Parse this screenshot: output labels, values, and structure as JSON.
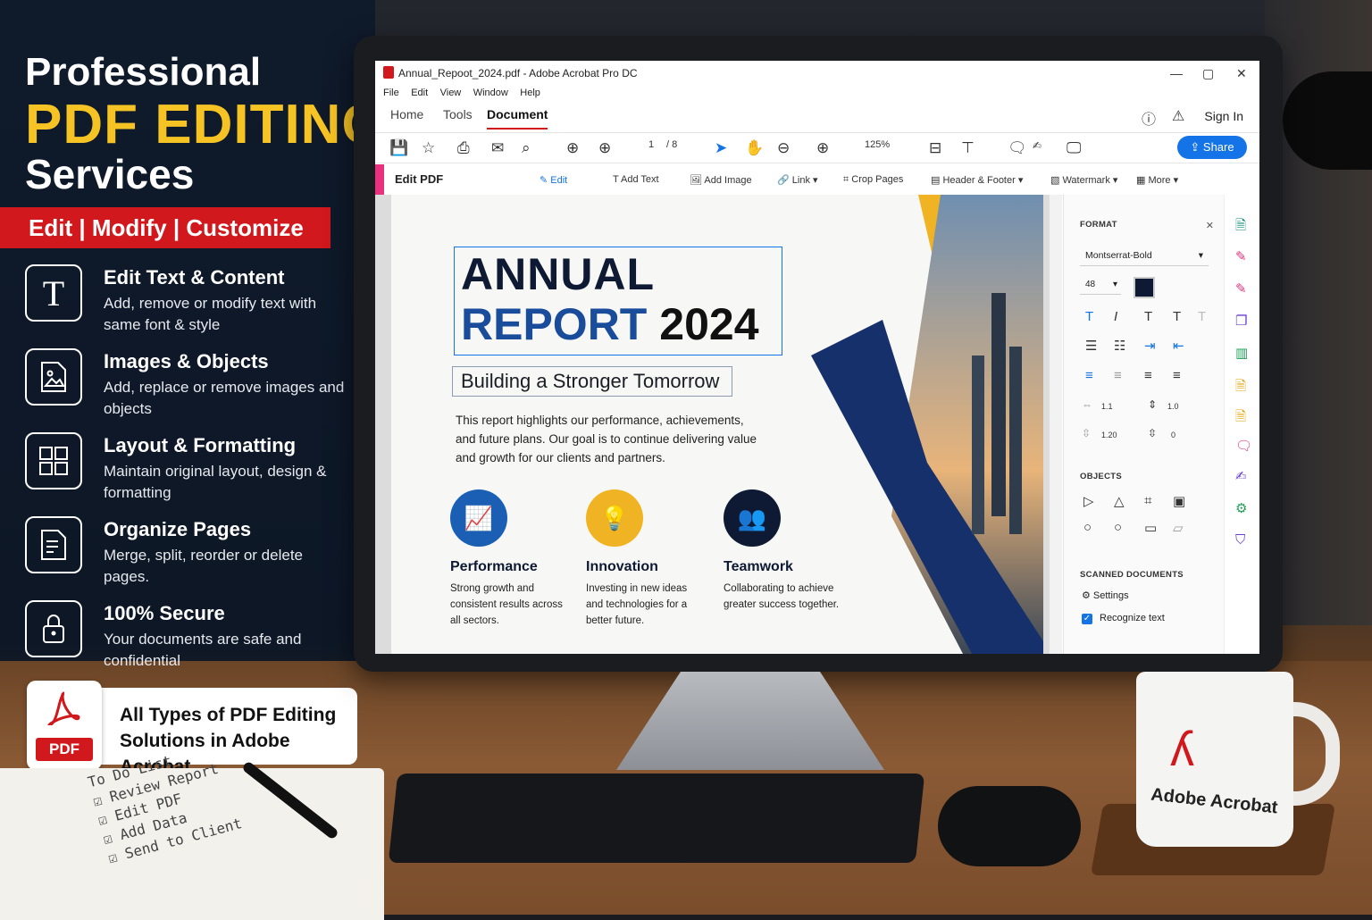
{
  "promo": {
    "title_line1": "Professional",
    "title_line2": "PDF EDITING",
    "title_line3": "Services",
    "ribbon": "Edit | Modify | Customize",
    "features": [
      {
        "title": "Edit Text & Content",
        "desc": "Add, remove or modify text with same font & style"
      },
      {
        "title": "Images & Objects",
        "desc": "Add, replace or remove images and objects"
      },
      {
        "title": "Layout & Formatting",
        "desc": "Maintain original layout, design & formatting"
      },
      {
        "title": "Organize Pages",
        "desc": "Merge, split, reorder or delete pages."
      },
      {
        "title": "100% Secure",
        "desc": "Your documents are safe and confidential"
      }
    ],
    "card_badge": "PDF",
    "card_line1": "All Types of PDF Editing",
    "card_line2": "Solutions in Adobe Acrobat"
  },
  "notebook": {
    "title": "To Do List",
    "items": [
      "Review Report",
      "Edit PDF",
      "Add Data",
      "Send to Client"
    ]
  },
  "app": {
    "title": "Annual_Repoot_2024.pdf - Adobe Acrobat Pro DC",
    "menu": [
      "File",
      "Edit",
      "View",
      "Window",
      "Help"
    ],
    "tabs": [
      "Home",
      "Tools",
      "Document"
    ],
    "sign_in": "Sign In",
    "share": "Share",
    "page_current": "1",
    "page_total": "/ 8",
    "zoom": "125%",
    "edit_title": "Edit PDF",
    "edit_tools": [
      "Edit",
      "Add Text",
      "Add Image",
      "Link",
      "Crop Pages",
      "Header & Footer",
      "Watermark",
      "More"
    ]
  },
  "doc": {
    "heading1": "ANNUAL",
    "heading2": "REPORT",
    "heading_year": "2024",
    "subtitle": "Building a Stronger Tomorrow",
    "intro": "This report highlights our performance, achievements, and future plans. Our goal is to continue delivering value and growth for our clients and partners.",
    "pillars": [
      {
        "title": "Performance",
        "desc": "Strong growth and consistent results across all sectors.",
        "color": "#1a5fb4"
      },
      {
        "title": "Innovation",
        "desc": "Investing in new ideas and technologies for a better future.",
        "color": "#f0b323"
      },
      {
        "title": "Teamwork",
        "desc": "Collaborating to achieve greater success together.",
        "color": "#0e1a33"
      }
    ]
  },
  "panel": {
    "format": "FORMAT",
    "font": "Montserrat-Bold",
    "size": "48",
    "color": "#0e1a33",
    "spacing_a": "1.1",
    "spacing_b": "1.0",
    "line_spacing": "1.20",
    "para_spacing": "0",
    "objects": "OBJECTS",
    "scanned": "SCANNED DOCUMENTS",
    "settings": "Settings",
    "recognize": "Recognize text"
  },
  "mug": {
    "label": "Adobe Acrobat"
  }
}
